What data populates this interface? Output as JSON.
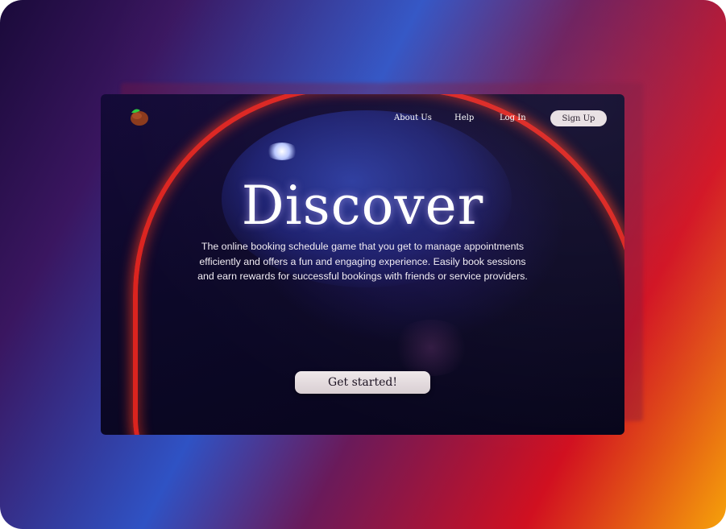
{
  "nav": {
    "about": "About Us",
    "help": "Help",
    "login": "Log In",
    "signup": "Sign Up"
  },
  "hero": {
    "title": "Discover",
    "description": "The online booking schedule game that you get to  manage appointments efficiently and offers a fun and engaging experience. Easily book sessions and earn rewards for successful bookings with friends or service providers.",
    "cta": "Get started!"
  },
  "colors": {
    "accent_red": "#ff2a1e",
    "button_bg": "#e8dfe2",
    "logo_green": "#2ecc40",
    "logo_body": "#8b3a1c"
  },
  "icons": {
    "logo": "fruit-logo-icon"
  }
}
